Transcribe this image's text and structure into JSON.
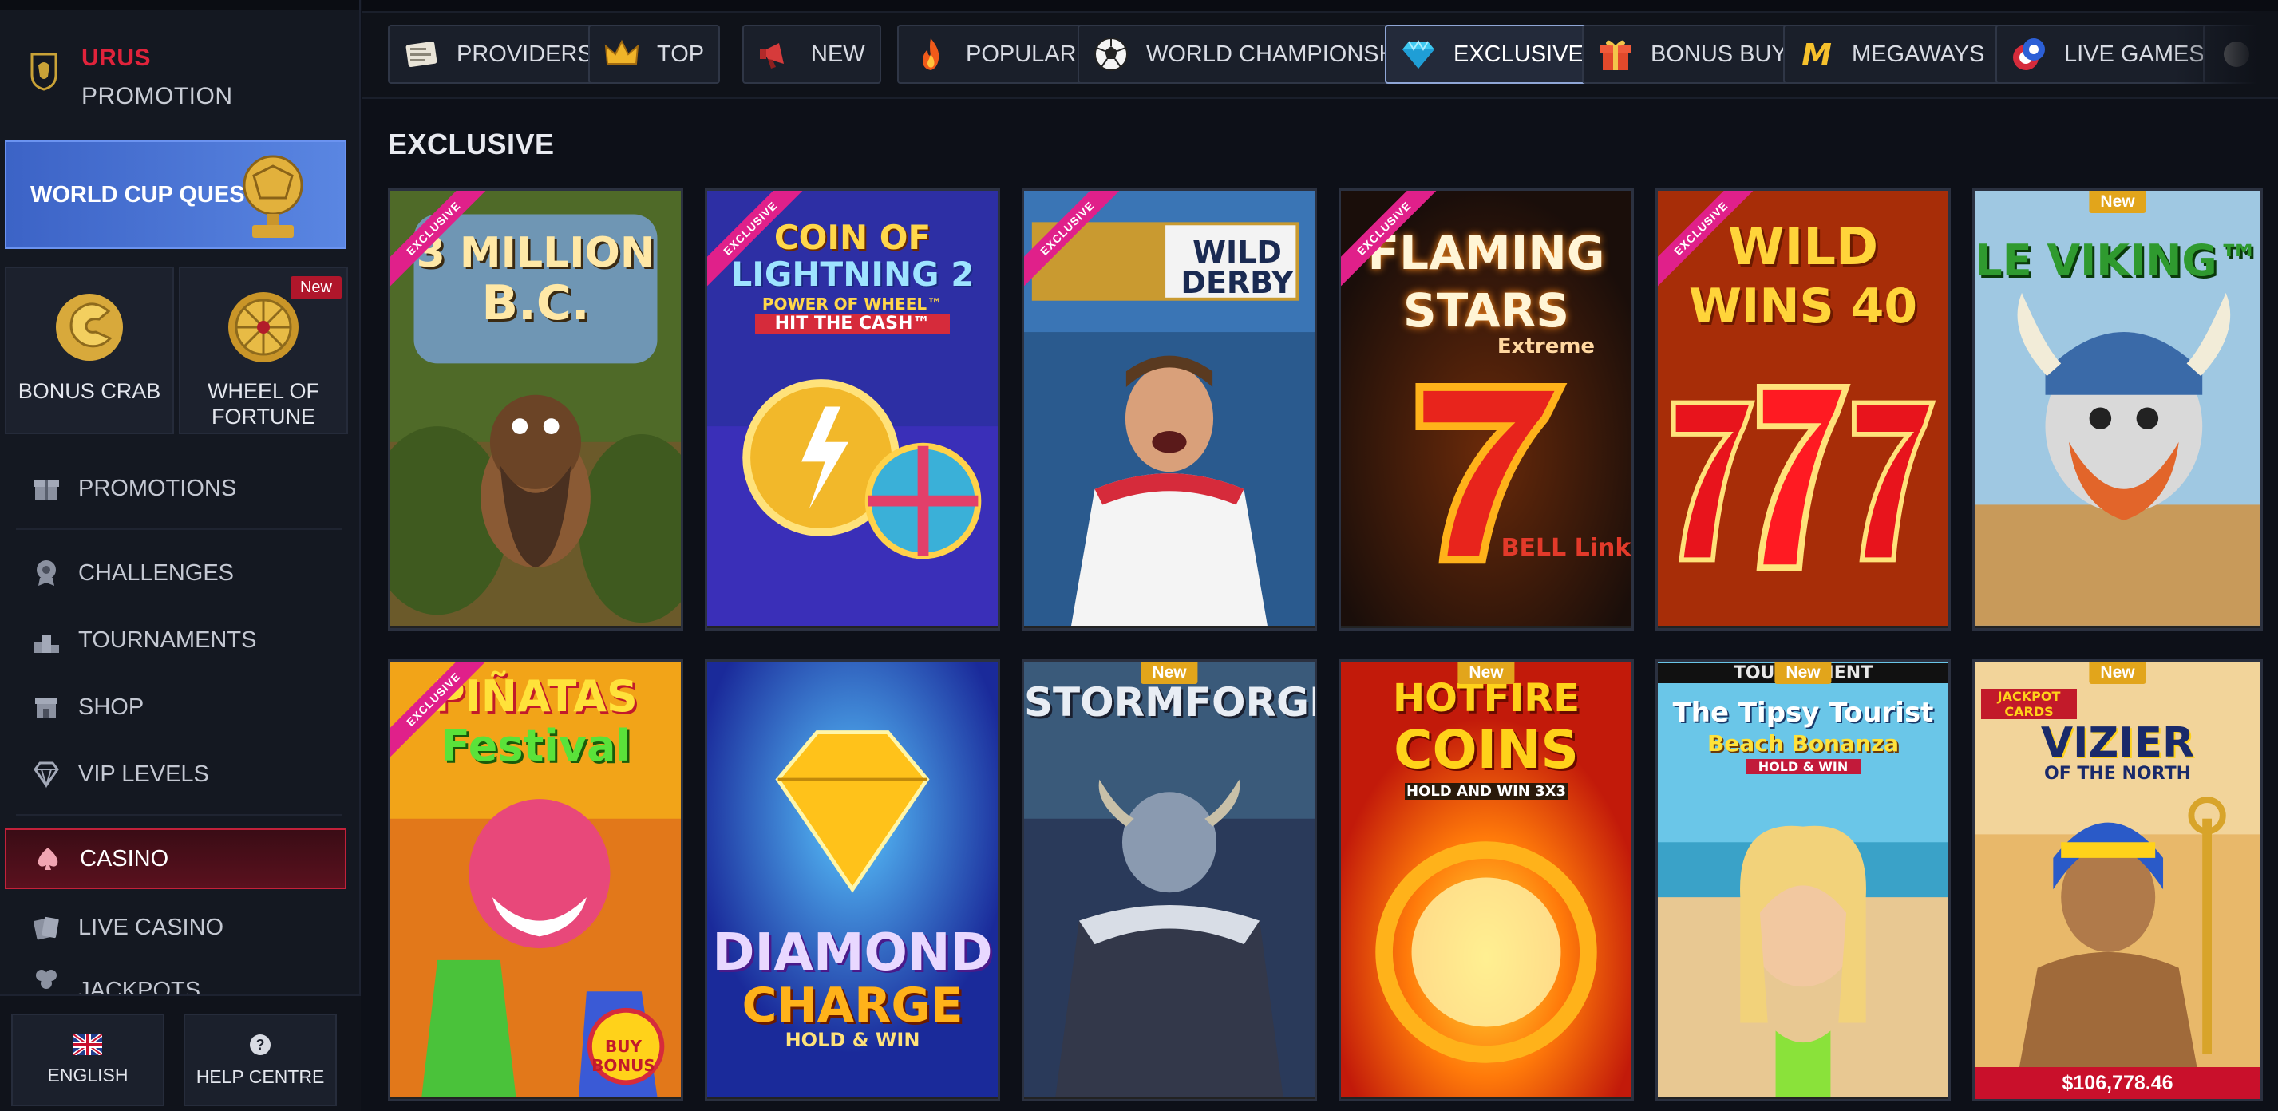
{
  "brand": {
    "line1": "URUS",
    "line2": "PROMOTION"
  },
  "quest": {
    "label": "WORLD CUP QUEST"
  },
  "tiles": [
    {
      "label_l1": "BONUS CRAB",
      "label_l2": ""
    },
    {
      "label_l1": "WHEEL OF",
      "label_l2": "FORTUNE",
      "badge": "New"
    }
  ],
  "nav": {
    "promotions": "PROMOTIONS",
    "challenges": "CHALLENGES",
    "tournaments": "TOURNAMENTS",
    "shop": "SHOP",
    "vip": "VIP LEVELS",
    "casino": "CASINO",
    "live_casino": "LIVE CASINO",
    "jackpots": "JACKPOTS"
  },
  "footer": {
    "language": "ENGLISH",
    "help": "HELP CENTRE"
  },
  "categories": [
    {
      "label": "PROVIDERS",
      "icon": "providers-icon"
    },
    {
      "label": "TOP",
      "icon": "crown-icon"
    },
    {
      "label": "NEW",
      "icon": "megaphone-icon"
    },
    {
      "label": "POPULAR",
      "icon": "flame-icon"
    },
    {
      "label": "WORLD CHAMPIONSHIP",
      "icon": "soccer-ball-icon"
    },
    {
      "label": "EXCLUSIVE",
      "icon": "diamond-icon",
      "active": true
    },
    {
      "label": "BONUS BUYS",
      "icon": "gift-icon"
    },
    {
      "label": "MEGAWAYS",
      "icon": "megaways-icon"
    },
    {
      "label": "LIVE GAMES",
      "icon": "poker-chip-icon"
    }
  ],
  "section_title": "EXCLUSIVE",
  "ribbon_text": "EXCLUSIVE",
  "new_badge": "New",
  "games": [
    {
      "title_l1": "3 MILLION",
      "title_l2": "B.C."
    },
    {
      "title_l1": "COIN OF",
      "title_l2": "LIGHTNING 2",
      "tag": "POWER OF WHEEL™",
      "tag2": "HIT THE CASH™"
    },
    {
      "title_l1": "WILD",
      "title_l2": "DERBY"
    },
    {
      "title_l1": "FLAMING",
      "title_l2": "STARS",
      "tag": "Extreme",
      "tag2": "BELL Link"
    },
    {
      "title_l1": "WILD",
      "title_l2": "WINS 40"
    },
    {
      "title_l1": "LE VIKING™",
      "title_l2": ""
    },
    {
      "title_l1": "PIÑATAS",
      "title_l2": "Festival",
      "tag": "BUY BONUS"
    },
    {
      "title_l1": "DIAMOND",
      "title_l2": "CHARGE",
      "tag": "HOLD & WIN"
    },
    {
      "title_l1": "STORMFORGED",
      "title_l2": ""
    },
    {
      "title_l1": "HOTFIRE",
      "title_l2": "COINS",
      "tag": "HOLD AND WIN 3x3"
    },
    {
      "title_l1": "The Tipsy Tourist",
      "title_l2": "Beach Bonanza",
      "tag": "HOLD & WIN",
      "tag2": "TOURNAMENT"
    },
    {
      "title_l1": "VIZIER",
      "title_l2": "OF THE NORTH",
      "tag": "JACKPOT CARDS",
      "jackpot": "$106,778.46"
    }
  ],
  "colors": {
    "accent_red": "#e0233b",
    "quest_blue": "#4a74d6",
    "ribbon_pink": "#e0208a",
    "new_gold": "#e2a51b"
  }
}
